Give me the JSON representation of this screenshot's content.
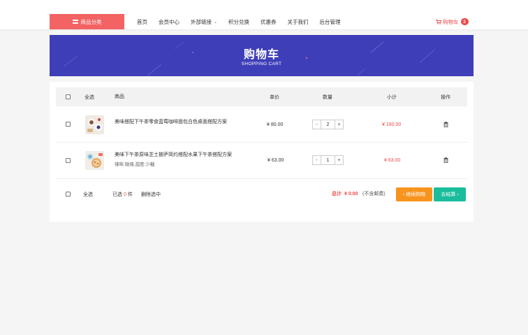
{
  "header": {
    "category_button": "商品分类",
    "nav": [
      {
        "label": "首页"
      },
      {
        "label": "会员中心"
      },
      {
        "label": "外部链接"
      },
      {
        "label": "积分兑换"
      },
      {
        "label": "优惠券"
      },
      {
        "label": "关于我们"
      },
      {
        "label": "后台管理"
      }
    ],
    "cart_label": "购物车",
    "cart_count": "2"
  },
  "banner": {
    "title": "购物车",
    "subtitle": "SHOPPING CART",
    "bg_color": "#3f3eb9"
  },
  "table": {
    "headers": {
      "select_all": "全选",
      "product": "商品",
      "price": "单价",
      "quantity": "数量",
      "subtotal": "小计",
      "action": "操作"
    },
    "items": [
      {
        "name": "美味搭配下午茶零食蓝莓咖啡面包白色桌面搭配方案",
        "spec": "",
        "price": "¥ 80.00",
        "qty": "2",
        "subtotal": "¥ 160.00",
        "qty_minus": "-",
        "qty_plus": "+"
      },
      {
        "name": "美味下午茶原味芝士披萨简约搭配水果下午茶搭配方案",
        "spec": "辣味:微辣,甜度:少糖",
        "price": "¥ 63.00",
        "qty": "1",
        "subtotal": "¥ 63.00",
        "qty_minus": "-",
        "qty_plus": "+"
      }
    ]
  },
  "footer": {
    "select_all": "全选",
    "selected_prefix": "已选",
    "selected_count": "0",
    "selected_suffix": "件",
    "delete_selected": "删除选中",
    "total_label": "总计",
    "total_value": "¥ 0.00",
    "shipping_note": "(不含邮费)",
    "continue_button": "继续购物",
    "checkout_button": "去结算"
  },
  "colors": {
    "accent_red": "#f04848",
    "category_bg": "#f36363",
    "continue_bg": "#f7941d",
    "checkout_bg": "#1abc9c"
  }
}
